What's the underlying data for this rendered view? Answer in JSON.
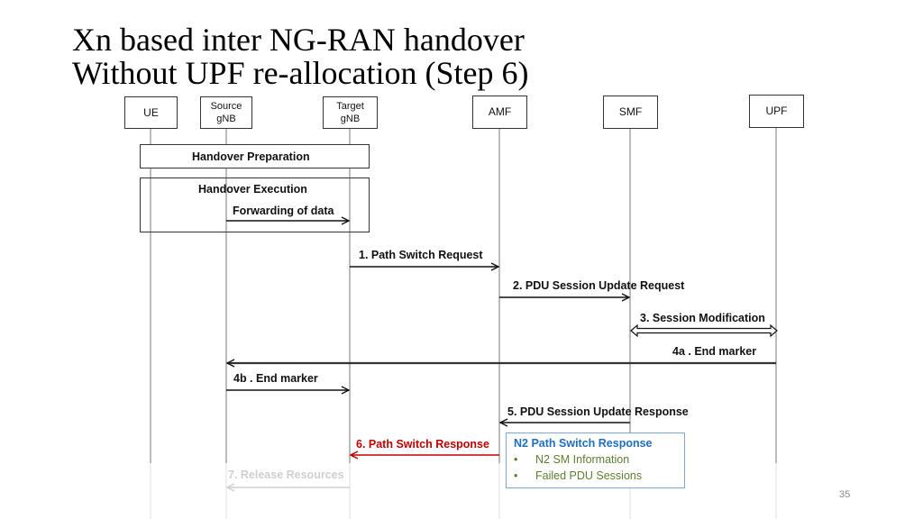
{
  "slide": {
    "title_line1": "Xn based inter NG-RAN handover",
    "title_line2": "Without UPF re-allocation (Step 6)",
    "page_number": "35"
  },
  "actors": [
    {
      "id": "ue",
      "label_line1": "UE",
      "label_line2": ""
    },
    {
      "id": "source-gnb",
      "label_line1": "Source",
      "label_line2": "gNB"
    },
    {
      "id": "target-gnb",
      "label_line1": "Target",
      "label_line2": "gNB"
    },
    {
      "id": "amf",
      "label_line1": "AMF",
      "label_line2": ""
    },
    {
      "id": "smf",
      "label_line1": "SMF",
      "label_line2": ""
    },
    {
      "id": "upf",
      "label_line1": "UPF",
      "label_line2": ""
    }
  ],
  "phases": {
    "preparation": "Handover Preparation",
    "execution": "Handover Execution"
  },
  "messages": [
    {
      "id": "forwarding",
      "label": "Forwarding of data",
      "from": "source-gnb",
      "to": "target-gnb",
      "style": "normal"
    },
    {
      "id": "step1",
      "label": "1. Path Switch Request",
      "from": "target-gnb",
      "to": "amf",
      "style": "normal"
    },
    {
      "id": "step2",
      "label": "2. PDU Session Update Request",
      "from": "amf",
      "to": "smf",
      "style": "normal"
    },
    {
      "id": "step3",
      "label": "3. Session Modification",
      "from": "smf",
      "to": "upf",
      "style": "bidirectional"
    },
    {
      "id": "step4a",
      "label": "4a . End marker",
      "from": "upf",
      "to": "source-gnb",
      "style": "thick"
    },
    {
      "id": "step4b",
      "label": "4b . End marker",
      "from": "source-gnb",
      "to": "target-gnb",
      "style": "normal"
    },
    {
      "id": "step5",
      "label": "5. PDU Session Update Response",
      "from": "smf",
      "to": "amf",
      "style": "normal"
    },
    {
      "id": "step6",
      "label": "6. Path Switch Response",
      "from": "amf",
      "to": "target-gnb",
      "style": "highlight"
    },
    {
      "id": "step7",
      "label": "7. Release Resources",
      "from": "target-gnb",
      "to": "source-gnb",
      "style": "faded"
    }
  ],
  "info_box": {
    "title": "N2 Path Switch Response",
    "items": [
      "N2 SM Information",
      "Failed PDU Sessions"
    ],
    "bullet": "•"
  },
  "colors": {
    "highlight": "#c00000",
    "faded": "#cfcfcf",
    "info_title": "#1f6fbf",
    "info_items": "#5c7f2f",
    "info_border": "#7ea6d6"
  }
}
